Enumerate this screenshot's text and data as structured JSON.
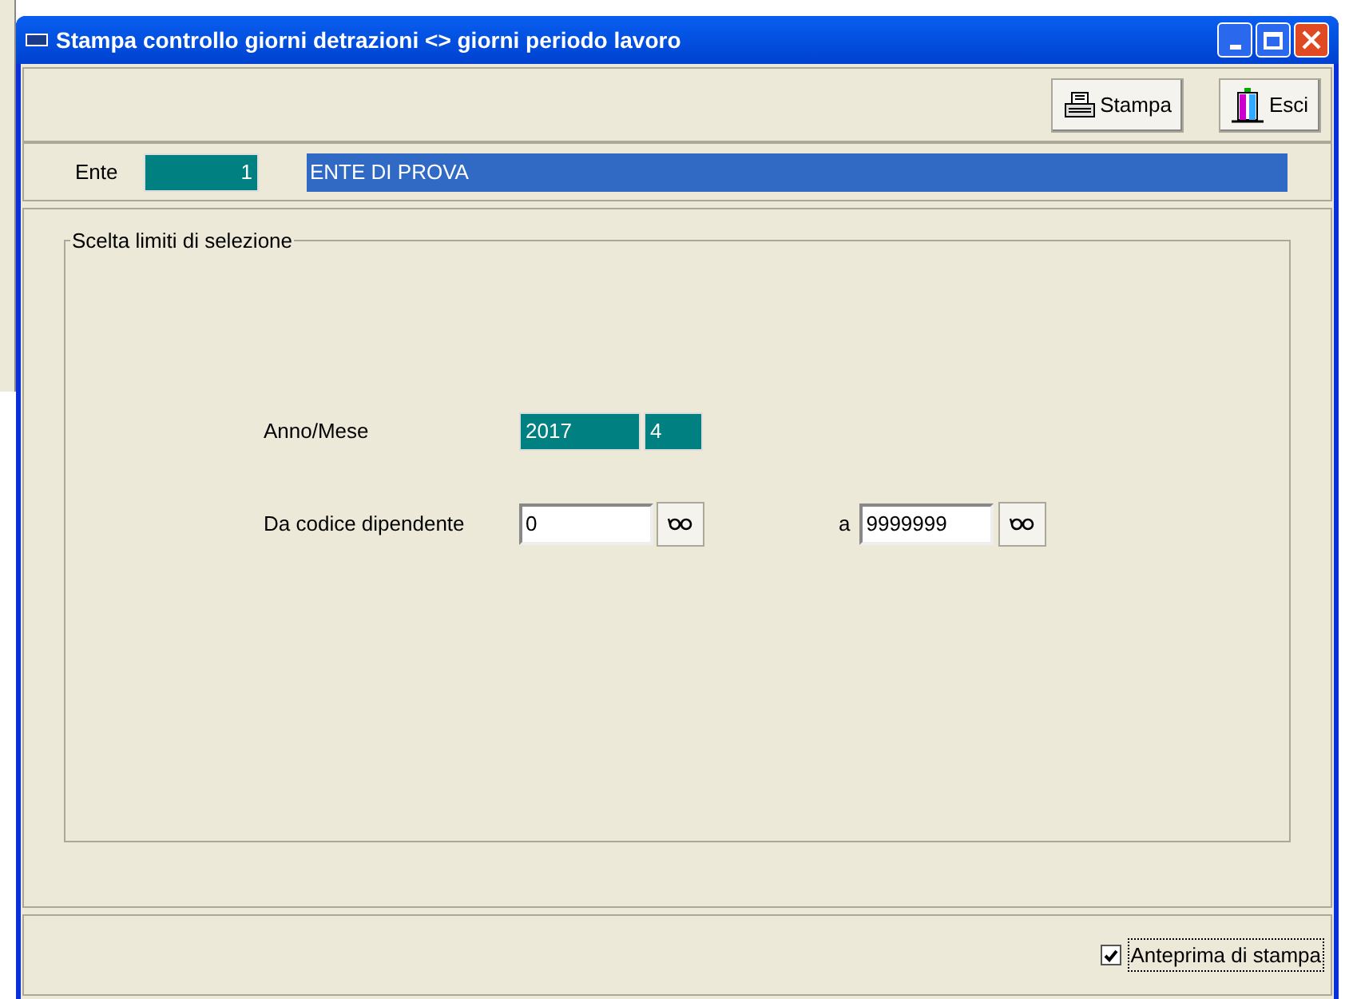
{
  "window": {
    "title": "Stampa controllo giorni detrazioni <> giorni periodo lavoro"
  },
  "toolbar": {
    "buttons": [
      {
        "kind": "print",
        "label": "Stampa"
      },
      {
        "kind": "exit",
        "label": "Esci"
      }
    ]
  },
  "ente": {
    "label": "Ente",
    "code": "1",
    "name": "ENTE DI PROVA"
  },
  "selection": {
    "title": "Scelta limiti di selezione",
    "anno_mese": {
      "label": "Anno/Mese",
      "year": "2017",
      "month": "4"
    },
    "codice": {
      "label": "Da codice dipendente",
      "from": "0",
      "to_label": "a",
      "to": "9999999"
    }
  },
  "footer": {
    "preview": {
      "label": "Anteprima di stampa",
      "checked": true
    }
  }
}
